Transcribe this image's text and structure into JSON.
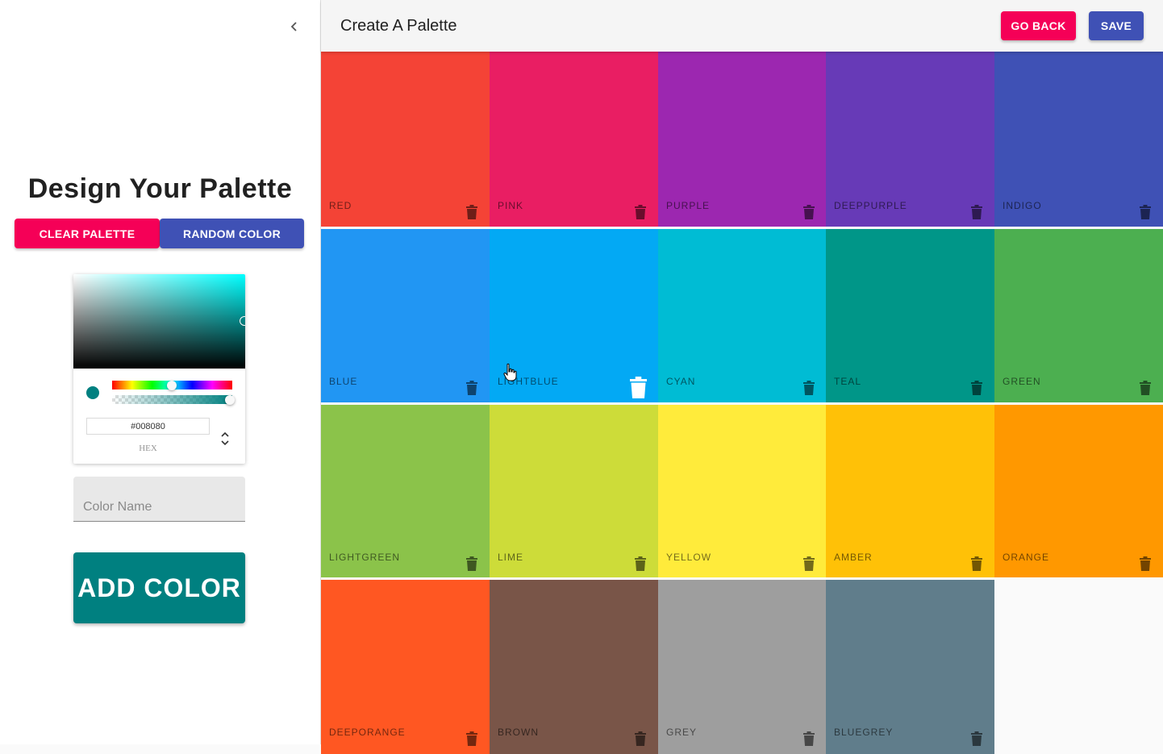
{
  "drawer": {
    "collapse_icon": "chevron-left-icon",
    "title": "Design Your Palette",
    "clear_label": "CLEAR PALETTE",
    "random_label": "RANDOM COLOR"
  },
  "picker": {
    "hex_value": "#008080",
    "hex_label": "HEX",
    "current_color": "#008080",
    "hue_level": 0.48,
    "alpha_level": 1.0
  },
  "name_field": {
    "placeholder": "Color Name"
  },
  "add_button": {
    "label": "ADD COLOR",
    "color": "#008080"
  },
  "appbar": {
    "title": "Create A Palette",
    "goback_label": "GO BACK",
    "save_label": "SAVE"
  },
  "colors": [
    {
      "name": "RED",
      "color": "#f44336"
    },
    {
      "name": "PINK",
      "color": "#e91e63"
    },
    {
      "name": "PURPLE",
      "color": "#9c27b0"
    },
    {
      "name": "DEEPPURPLE",
      "color": "#673ab7"
    },
    {
      "name": "INDIGO",
      "color": "#3f51b5"
    },
    {
      "name": "BLUE",
      "color": "#2196f3"
    },
    {
      "name": "LIGHTBLUE",
      "color": "#03a9f4"
    },
    {
      "name": "CYAN",
      "color": "#00bcd4"
    },
    {
      "name": "TEAL",
      "color": "#009688"
    },
    {
      "name": "GREEN",
      "color": "#4caf50"
    },
    {
      "name": "LIGHTGREEN",
      "color": "#8bc34a"
    },
    {
      "name": "LIME",
      "color": "#cddc39"
    },
    {
      "name": "YELLOW",
      "color": "#ffeb3b"
    },
    {
      "name": "AMBER",
      "color": "#ffc107"
    },
    {
      "name": "ORANGE",
      "color": "#ff9800"
    },
    {
      "name": "DEEPORANGE",
      "color": "#ff5722"
    },
    {
      "name": "BROWN",
      "color": "#795548"
    },
    {
      "name": "GREY",
      "color": "#9e9e9e"
    },
    {
      "name": "BLUEGREY",
      "color": "#607d8b"
    }
  ],
  "hovered_color": "LIGHTBLUE"
}
